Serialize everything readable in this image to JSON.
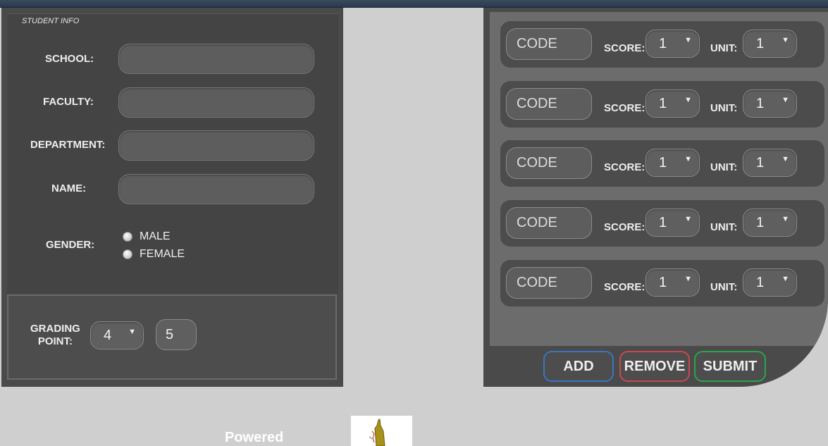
{
  "student_info": {
    "legend": "STUDENT INFO",
    "school_label": "SCHOOL:",
    "faculty_label": "FACULTY:",
    "department_label": "DEPARTMENT:",
    "name_label": "NAME:",
    "gender_label": "GENDER:",
    "gender_options": [
      "MALE",
      "FEMALE"
    ]
  },
  "grading": {
    "label_line1": "GRADING",
    "label_line2": "POINT:",
    "selected": "4",
    "value": "5"
  },
  "courses": [
    {
      "code_placeholder": "CODE",
      "score_label": "SCORE:",
      "score": "1",
      "unit_label": "UNIT:",
      "unit": "1"
    },
    {
      "code_placeholder": "CODE",
      "score_label": "SCORE:",
      "score": "1",
      "unit_label": "UNIT:",
      "unit": "1"
    },
    {
      "code_placeholder": "CODE",
      "score_label": "SCORE:",
      "score": "1",
      "unit_label": "UNIT:",
      "unit": "1"
    },
    {
      "code_placeholder": "CODE",
      "score_label": "SCORE:",
      "score": "1",
      "unit_label": "UNIT:",
      "unit": "1"
    },
    {
      "code_placeholder": "CODE",
      "score_label": "SCORE:",
      "score": "1",
      "unit_label": "UNIT:",
      "unit": "1"
    }
  ],
  "buttons": {
    "add": "ADD",
    "remove": "REMOVE",
    "submit": "SUBMIT"
  },
  "footer": {
    "powered_text": "Powered"
  },
  "colors": {
    "add_border": "#3b74c4",
    "remove_border": "#c9484f",
    "submit_border": "#2aa54a"
  }
}
